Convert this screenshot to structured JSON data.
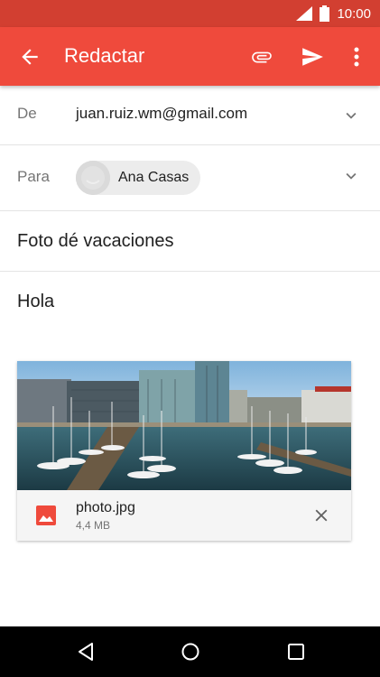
{
  "status_bar": {
    "time": "10:00",
    "icons": [
      "signal-icon",
      "battery-icon"
    ]
  },
  "app_bar": {
    "title": "Redactar",
    "icons": [
      "back-arrow-icon",
      "attach-icon",
      "send-icon",
      "more-vert-icon"
    ]
  },
  "compose": {
    "from_label": "De",
    "from_value": "juan.ruiz.wm@gmail.com",
    "to_label": "Para",
    "to_recipient": "Ana Casas",
    "subject": "Foto dé vacaciones",
    "body": "Hola"
  },
  "attachment": {
    "name": "photo.jpg",
    "size": "4,4 MB",
    "icons": [
      "image-icon",
      "close-icon"
    ]
  },
  "nav_bar": {
    "icons": [
      "nav-back-icon",
      "nav-home-icon",
      "nav-recents-icon"
    ]
  },
  "colors": {
    "status_bar": "#d23f31",
    "app_bar": "#ef4a3c",
    "attachment_icon": "#ef4a3c"
  }
}
